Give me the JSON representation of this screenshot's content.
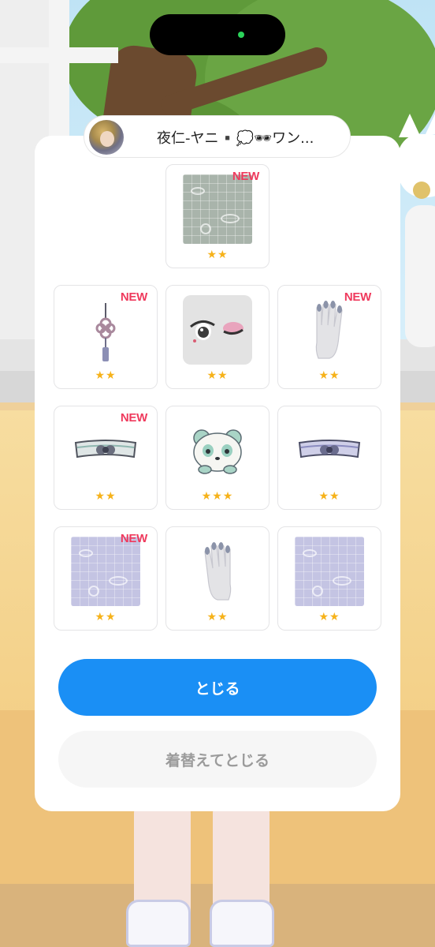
{
  "user": {
    "name": "夜仁-ヤニ▪️💭🕶ワン..."
  },
  "items": [
    {
      "name": "dragon-fan-pattern-green",
      "is_new": true,
      "new_label": "NEW",
      "stars": "★★"
    },
    {
      "name": "tassel-knot-earring",
      "is_new": true,
      "new_label": "NEW",
      "stars": "★★"
    },
    {
      "name": "winking-eye-makeup",
      "is_new": false,
      "new_label": "",
      "stars": "★★"
    },
    {
      "name": "grey-glove-right",
      "is_new": true,
      "new_label": "NEW",
      "stars": "★★"
    },
    {
      "name": "knot-belt-grey",
      "is_new": true,
      "new_label": "NEW",
      "stars": "★★"
    },
    {
      "name": "panda-hairclip",
      "is_new": false,
      "new_label": "",
      "stars": "★★★"
    },
    {
      "name": "knot-belt-purple",
      "is_new": false,
      "new_label": "",
      "stars": "★★"
    },
    {
      "name": "dragon-fan-pattern-purple",
      "is_new": true,
      "new_label": "NEW",
      "stars": "★★"
    },
    {
      "name": "grey-glove-left",
      "is_new": false,
      "new_label": "",
      "stars": "★★"
    },
    {
      "name": "dragon-fan-pattern-purple-2",
      "is_new": false,
      "new_label": "",
      "stars": "★★"
    }
  ],
  "buttons": {
    "close_label": "とじる",
    "change_and_close_label": "着替えてとじる"
  },
  "colors": {
    "primary": "#1a8ff5",
    "new_badge": "#ef3a5d",
    "star": "#f6b21a",
    "secondary_button_bg": "#f6f6f6",
    "secondary_button_text": "#9b9b9b"
  }
}
